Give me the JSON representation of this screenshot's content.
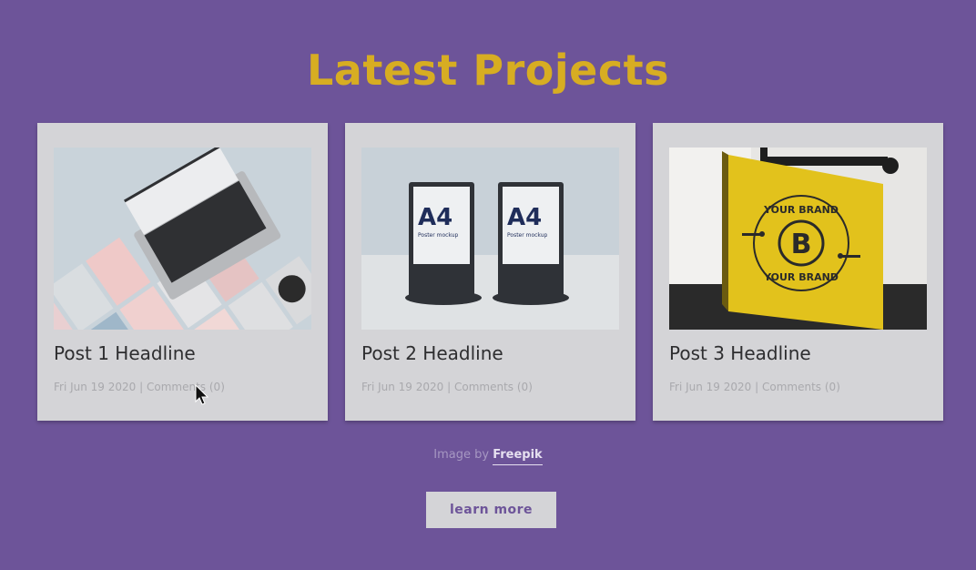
{
  "section": {
    "title": "Latest Projects"
  },
  "posts": [
    {
      "headline": "Post 1 Headline",
      "date": "Fri Jun 19 2020",
      "separator": "|",
      "comments": "Comments (0)"
    },
    {
      "headline": "Post 2 Headline",
      "date": "Fri Jun 19 2020",
      "separator": "|",
      "comments": "Comments (0)"
    },
    {
      "headline": "Post 3 Headline",
      "date": "Fri Jun 19 2020",
      "separator": "|",
      "comments": "Comments (0)"
    }
  ],
  "images": {
    "poster_text": "A4",
    "poster_sub": "Poster mockup",
    "sign_top": "YOUR BRAND",
    "sign_letter": "B",
    "sign_bottom": "YOUR BRAND"
  },
  "credit": {
    "prefix": "Image by",
    "link": "Freepik"
  },
  "cta": {
    "label": "learn more"
  },
  "colors": {
    "background": "#6d5499",
    "title": "#d7ad22",
    "card": "#d4d4d7",
    "sign": "#e2c21c"
  }
}
